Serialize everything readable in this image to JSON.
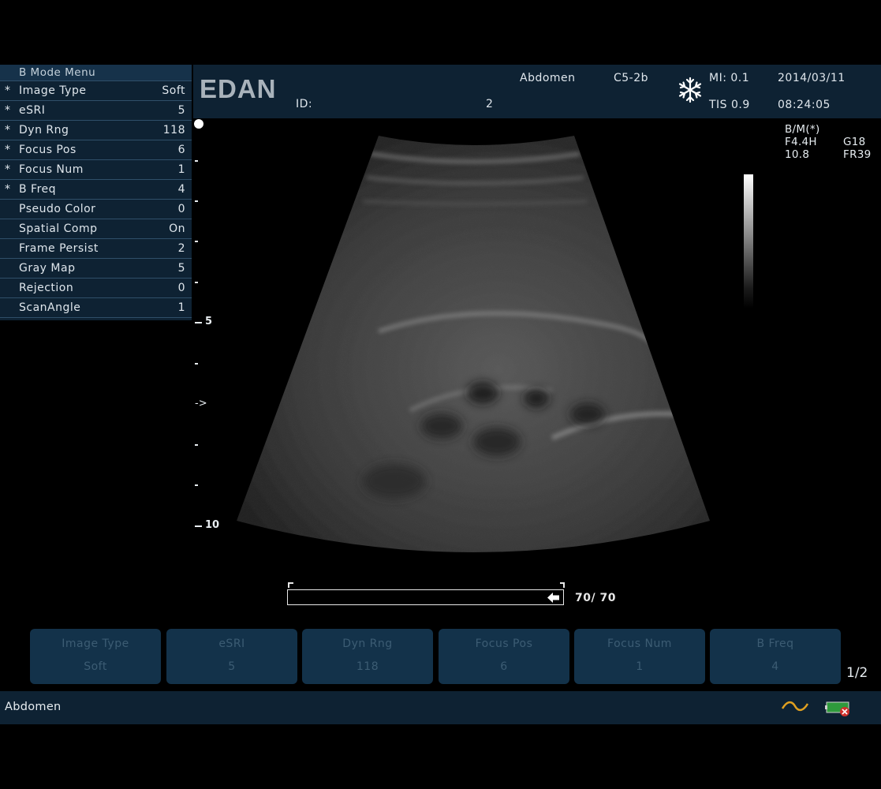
{
  "menu": {
    "title": "B Mode Menu",
    "items": [
      {
        "star": "*",
        "label": "Image Type",
        "value": "Soft"
      },
      {
        "star": "*",
        "label": "eSRI",
        "value": "5"
      },
      {
        "star": "*",
        "label": "Dyn Rng",
        "value": "118"
      },
      {
        "star": "*",
        "label": "Focus Pos",
        "value": "6"
      },
      {
        "star": "*",
        "label": "Focus Num",
        "value": "1"
      },
      {
        "star": "*",
        "label": "B Freq",
        "value": "4"
      },
      {
        "star": "",
        "label": "Pseudo Color",
        "value": "0"
      },
      {
        "star": "",
        "label": "Spatial Comp",
        "value": "On"
      },
      {
        "star": "",
        "label": "Frame Persist",
        "value": "2"
      },
      {
        "star": "",
        "label": "Gray Map",
        "value": "5"
      },
      {
        "star": "",
        "label": "Rejection",
        "value": "0"
      },
      {
        "star": "",
        "label": "ScanAngle",
        "value": "1"
      }
    ]
  },
  "header": {
    "logo": "EDAN",
    "id_label": "ID:",
    "id_value": "2",
    "exam": "Abdomen",
    "probe": "C5-2b",
    "mi": "MI: 0.1",
    "tis": "TIS 0.9",
    "date": "2014/03/11",
    "time": "08:24:05",
    "freeze_icon": "snowflake-icon"
  },
  "depth_scale": {
    "label_5": "5",
    "label_10": "10",
    "focus_marker": "->"
  },
  "image_info": {
    "mode": "B/M(*)",
    "freq": "F4.4H",
    "gain": "G18",
    "depth": "10.8",
    "frame_rate": "FR39"
  },
  "cine": {
    "text": "70/ 70",
    "progress": 1.0
  },
  "softkeys": [
    {
      "label": "Image Type",
      "value": "Soft"
    },
    {
      "label": "eSRI",
      "value": "5"
    },
    {
      "label": "Dyn Rng",
      "value": "118"
    },
    {
      "label": "Focus Pos",
      "value": "6"
    },
    {
      "label": "Focus Num",
      "value": "1"
    },
    {
      "label": "B Freq",
      "value": "4"
    }
  ],
  "softkey_page": "1/2",
  "status": {
    "exam": "Abdomen",
    "ac_icon": "ac-power-icon",
    "battery_icon": "battery-error-icon"
  }
}
